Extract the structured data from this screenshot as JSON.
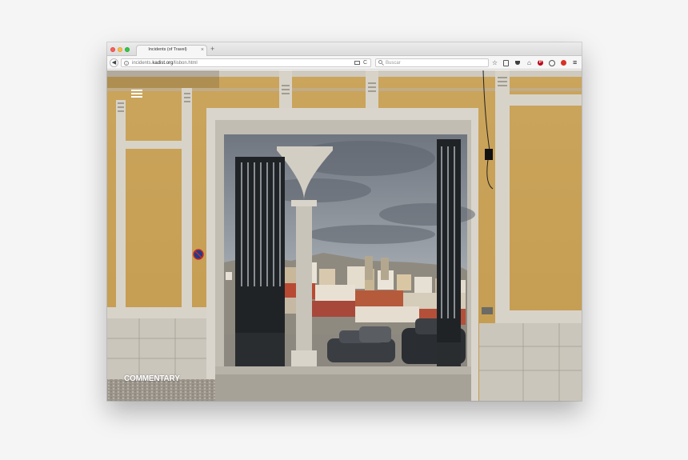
{
  "browser": {
    "tab": {
      "title": "Incidents (of Travel)",
      "close_glyph": "×"
    },
    "new_tab_glyph": "+",
    "back_glyph": "◀",
    "reload_glyph": "C",
    "url": {
      "prefix": "incidents.",
      "domain": "kadist.org",
      "path": "/lisbon.html"
    },
    "search": {
      "placeholder": "Buscar"
    },
    "toolbar_icons": [
      "star-icon",
      "clipboard-icon",
      "pocket-icon",
      "home-icon",
      "pinterest-icon",
      "download-icon",
      "stop-icon",
      "menu-icon"
    ]
  },
  "page": {
    "commentary_label": "COMMENTARY",
    "menu_icon": "hamburger-icon"
  },
  "colors": {
    "wall": "#c8a35a",
    "stone": "#d6d3cc",
    "sky": "#8d9298"
  }
}
